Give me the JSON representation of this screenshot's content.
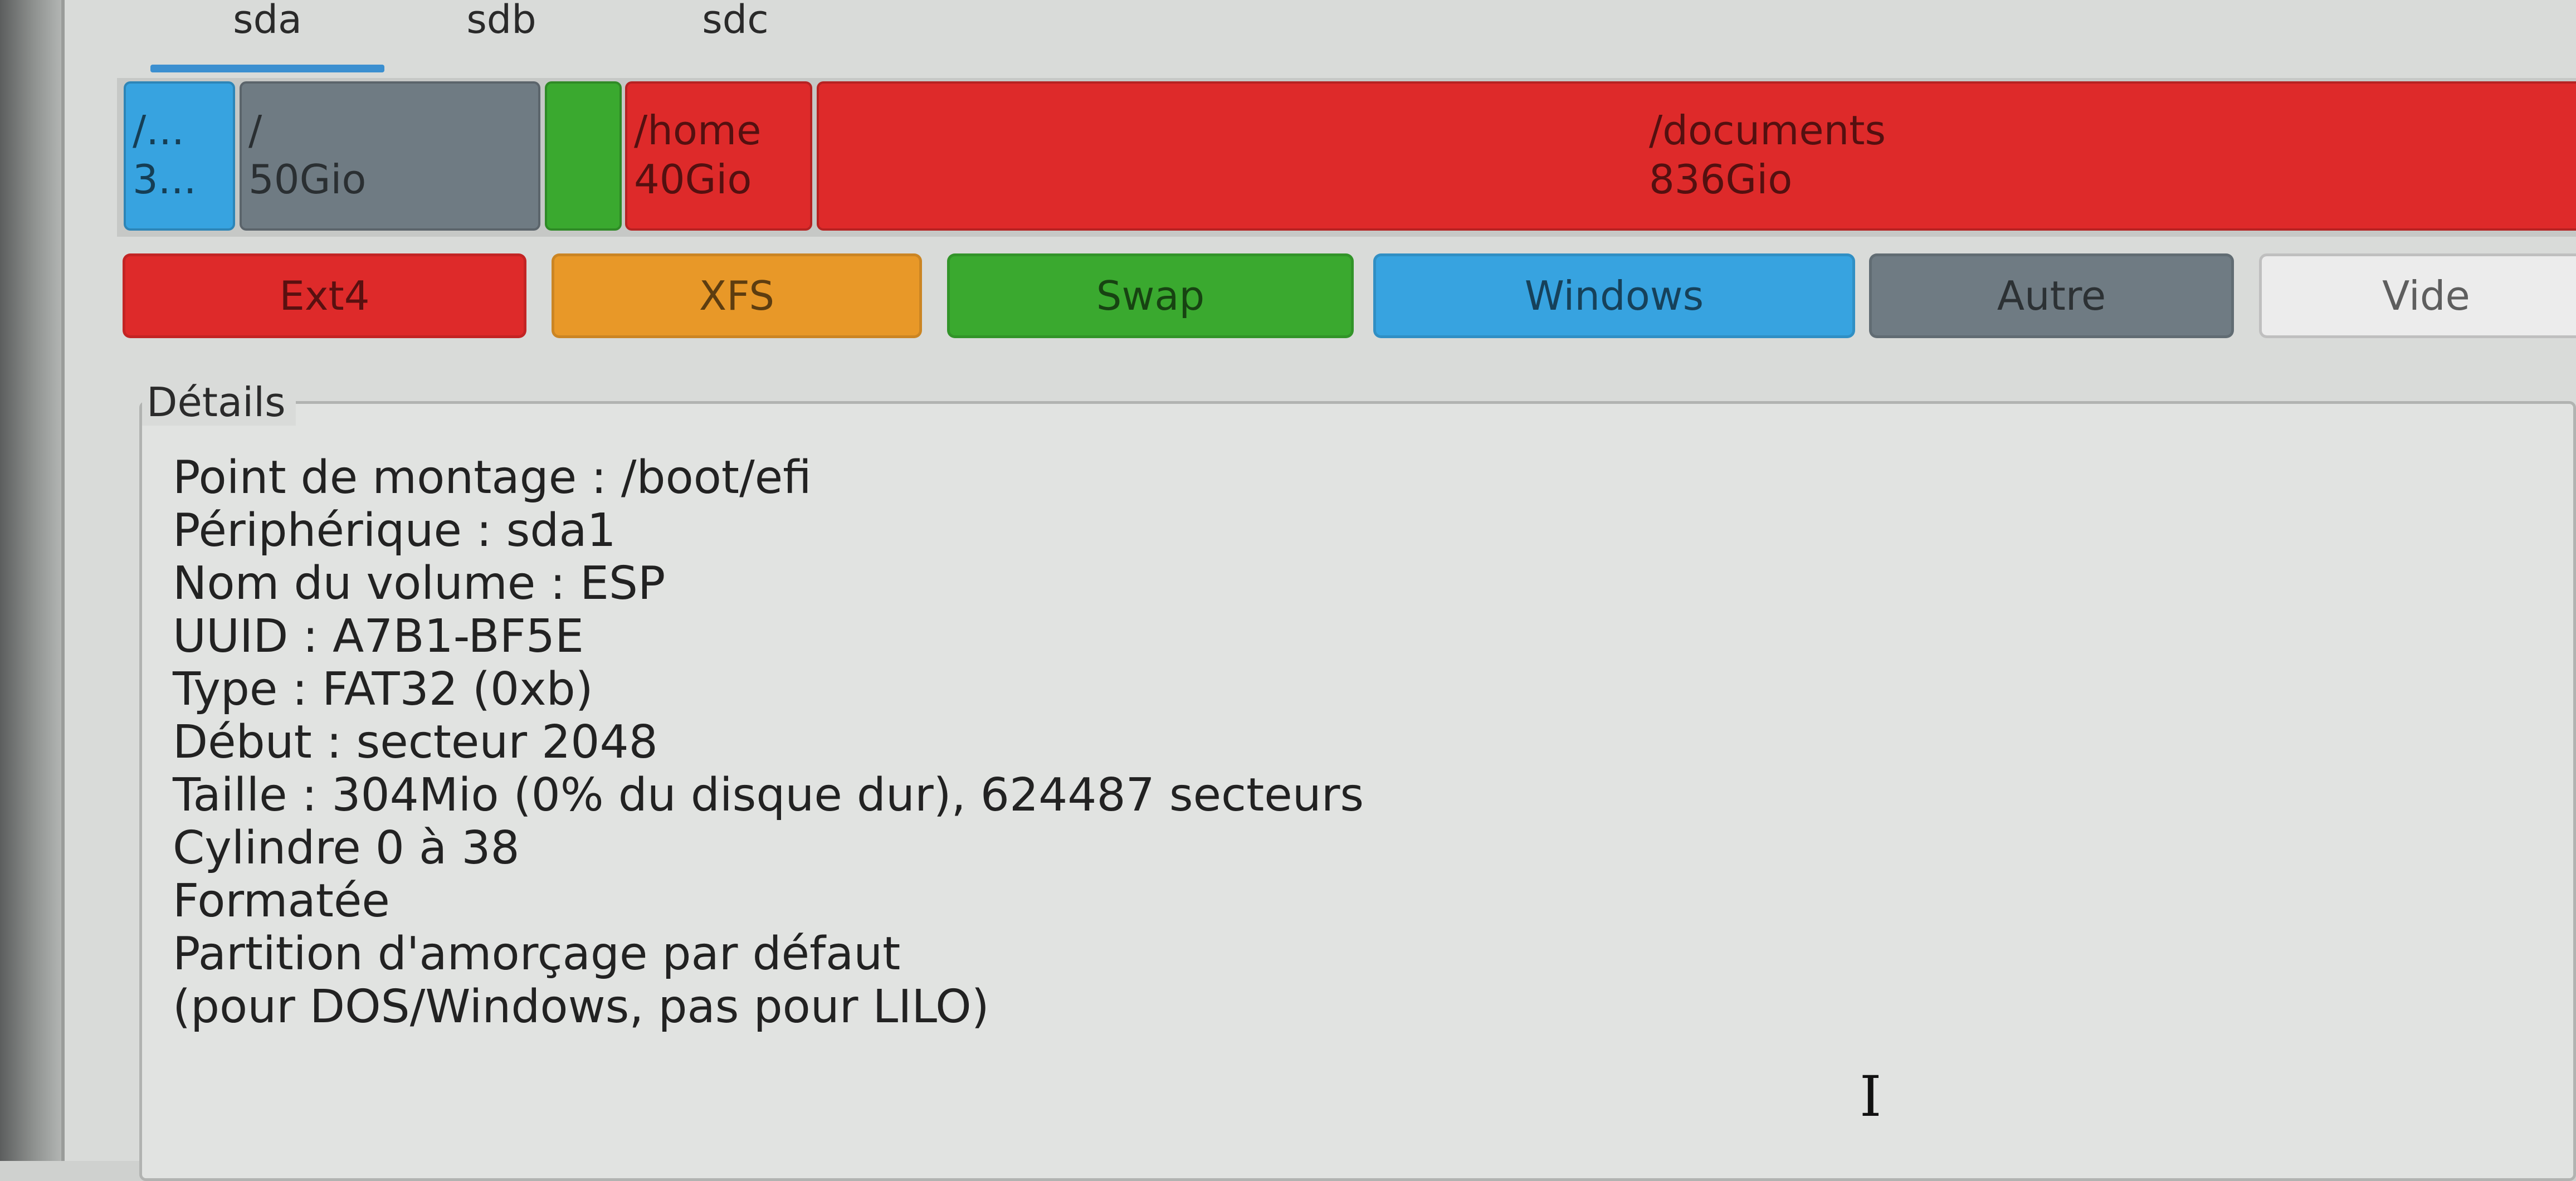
{
  "tabs": [
    {
      "label": "sda",
      "active": true
    },
    {
      "label": "sdb",
      "active": false
    },
    {
      "label": "sdc",
      "active": false
    }
  ],
  "partitions": [
    {
      "mount": "/...",
      "size": "3...",
      "color": "#37a3e0"
    },
    {
      "mount": "/",
      "size": "50Gio",
      "color": "#6f7b83"
    },
    {
      "mount": "",
      "size": "",
      "color": "#3aa92f"
    },
    {
      "mount": "/home",
      "size": "40Gio",
      "color": "#de2a2a"
    },
    {
      "mount": "/documents",
      "size": "836Gio",
      "color": "#de2a2a"
    }
  ],
  "legend": [
    {
      "label": "Ext4",
      "color": "#de2a2a"
    },
    {
      "label": "XFS",
      "color": "#e89828"
    },
    {
      "label": "Swap",
      "color": "#3aa92f"
    },
    {
      "label": "Windows",
      "color": "#37a3e0"
    },
    {
      "label": "Autre",
      "color": "#6f7b83"
    },
    {
      "label": "Vide",
      "color": "#ececec"
    }
  ],
  "details": {
    "title": "Détails",
    "lines": [
      "Point de montage : /boot/efi",
      "Périphérique : sda1",
      "Nom du volume : ESP",
      "UUID : A7B1-BF5E",
      "Type : FAT32 (0xb)",
      "Début : secteur 2048",
      "Taille : 304Mio (0% du disque dur), 624487 secteurs",
      "Cylindre 0 à 38",
      "Formatée",
      "Partition d'amorçage par défaut",
      "(pour DOS/Windows, pas pour LILO)"
    ]
  },
  "cursor": "I"
}
